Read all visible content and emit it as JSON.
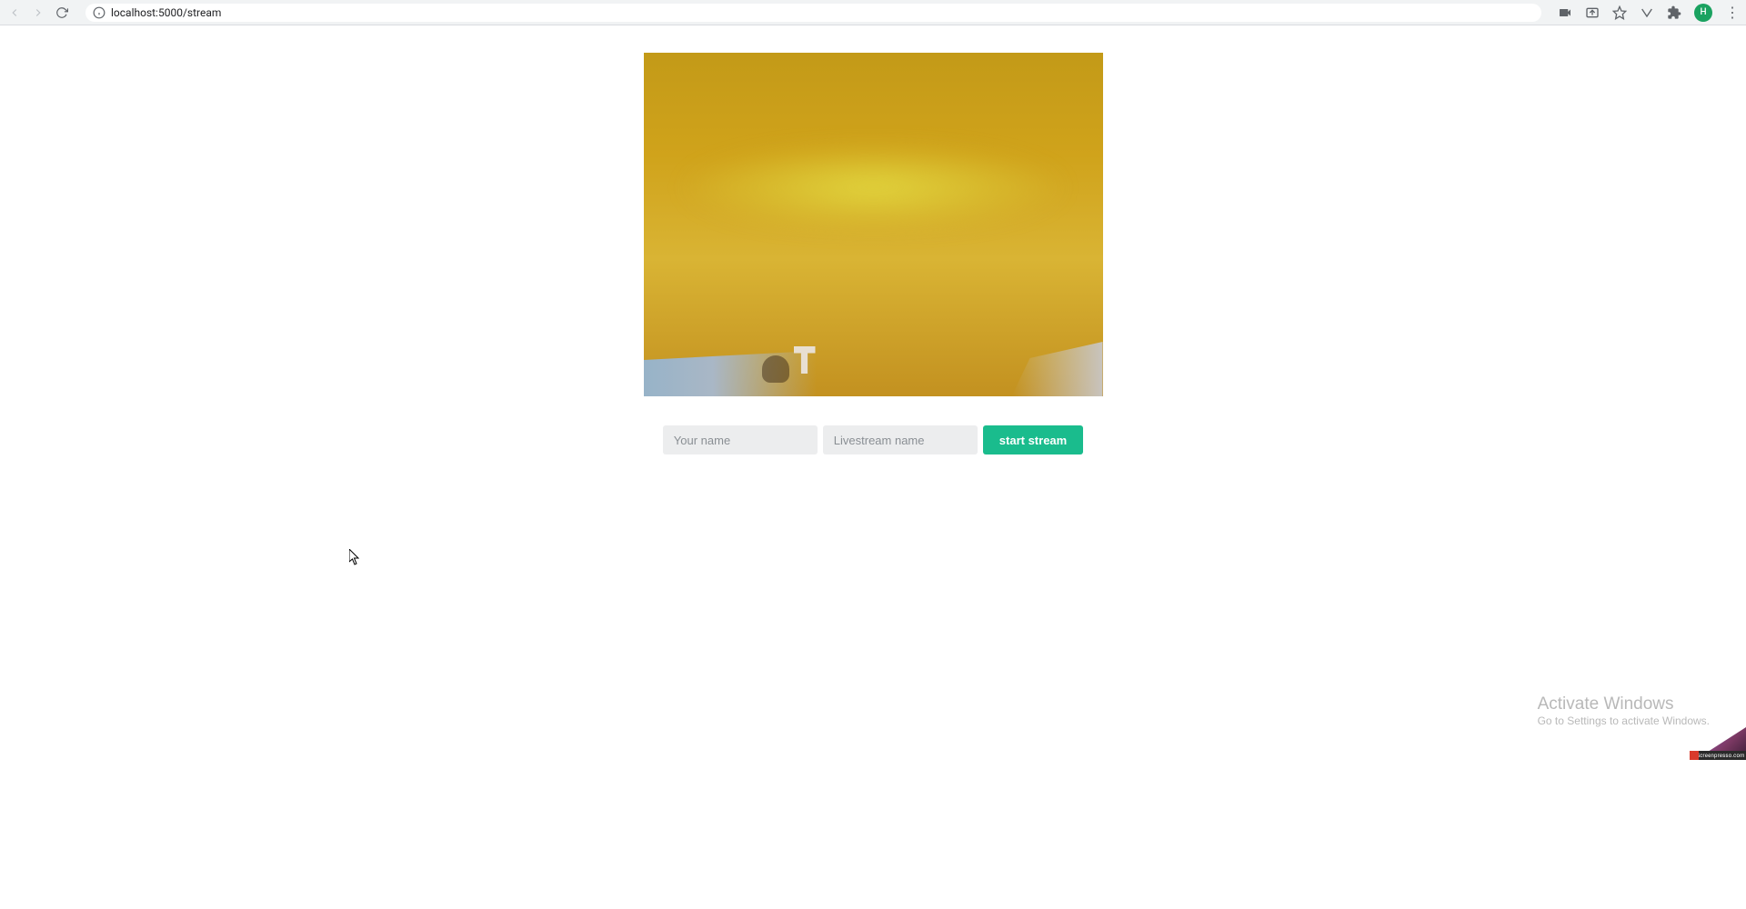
{
  "browser": {
    "url": "localhost:5000/stream",
    "avatar_letter": "H"
  },
  "form": {
    "name_placeholder": "Your name",
    "stream_placeholder": "Livestream name",
    "button_label": "start stream"
  },
  "watermark": {
    "title": "Activate Windows",
    "subtitle": "Go to Settings to activate Windows."
  },
  "corner_badge": {
    "label": "Screenpresso.com"
  }
}
